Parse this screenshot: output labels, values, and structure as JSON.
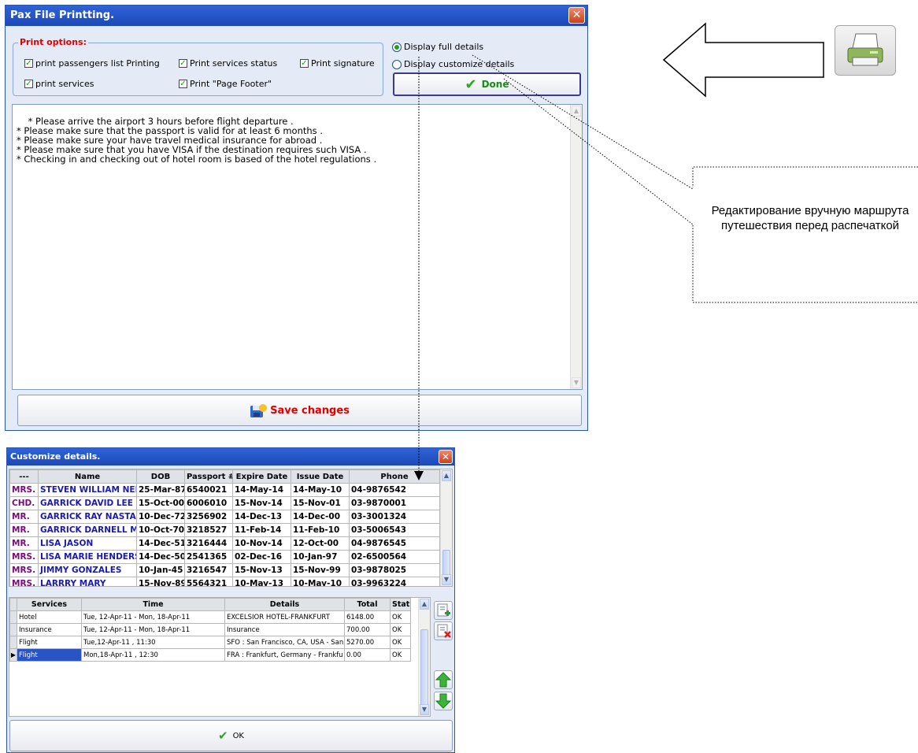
{
  "main_window": {
    "title": "Pax File Printting.",
    "print_options_title": "Print options:",
    "checkboxes": [
      {
        "label": "print passengers list Printing",
        "checked": true
      },
      {
        "label": "Print services status",
        "checked": true
      },
      {
        "label": "Print signature",
        "checked": true
      },
      {
        "label": "print services",
        "checked": true
      },
      {
        "label": "Print \"Page Footer\"",
        "checked": true
      }
    ],
    "radios": [
      {
        "label": "Display full details",
        "selected": true
      },
      {
        "label": "Display customize details",
        "selected": false
      }
    ],
    "done_label": "Done",
    "notes_text": "* Please arrive the airport 3 hours before flight departure .\n* Please make sure that the passport is valid for at least 6 months .\n* Please make sure your have travel medical insurance for abroad .\n* Please make sure that you have VISA if the destination requires such VISA .\n* Checking in and checking out of hotel room is based of the hotel regulations .",
    "save_label": "Save changes"
  },
  "customize_window": {
    "title": "Customize details.",
    "pax_headers": [
      "---",
      "Name",
      "DOB",
      "Passport #",
      "Expire Date",
      "Issue Date",
      "Phone"
    ],
    "pax_rows": [
      [
        "MRS.",
        "STEVEN WILLIAM NELS",
        "25-Mar-87",
        "6540021",
        "14-May-14",
        "14-May-10",
        "04-9876542"
      ],
      [
        "CHD.",
        "GARRICK DAVID LEE",
        "15-Oct-00",
        "6006010",
        "15-Nov-14",
        "15-Nov-01",
        "03-9870001"
      ],
      [
        "MR.",
        "GARRICK RAY NASTAS",
        "10-Dec-72",
        "3256902",
        "14-Dec-13",
        "14-Dec-00",
        "03-3001324"
      ],
      [
        "MR.",
        "GARRICK DARNELL MI",
        "10-Oct-70",
        "3218527",
        "11-Feb-14",
        "11-Feb-10",
        "03-5006543"
      ],
      [
        "MR.",
        "LISA JASON",
        "14-Dec-51",
        "3216444",
        "10-Nov-14",
        "12-Oct-00",
        "04-9876545"
      ],
      [
        "MRS.",
        "LISA MARIE HENDERSI",
        "14-Dec-50",
        "2541365",
        "02-Dec-16",
        "10-Jan-97",
        "02-6500564"
      ],
      [
        "MRS.",
        "JIMMY GONZALES",
        "10-Jan-45",
        "3216547",
        "15-Nov-13",
        "15-Nov-99",
        "03-9878025"
      ],
      [
        "MRS.",
        "LARRRY MARY",
        "15-Nov-89",
        "5564321",
        "10-May-13",
        "10-May-10",
        "03-9963224"
      ]
    ],
    "service_headers": [
      "Services",
      "Time",
      "Details",
      "Total",
      "Stat."
    ],
    "service_rows": [
      [
        "Hotel",
        "Tue, 12-Apr-11 - Mon, 18-Apr-11",
        "EXCELSIOR HOTEL-FRANKFURT",
        "6148.00",
        "OK"
      ],
      [
        "Insurance",
        "Tue, 12-Apr-11 - Mon, 18-Apr-11",
        "Insurance",
        "700.00",
        "OK"
      ],
      [
        "Flight",
        "Tue,12-Apr-11 , 11:30",
        "SFO : San Francisco, CA, USA - San",
        "5270.00",
        "OK"
      ],
      [
        "Flight",
        "Mon,18-Apr-11 , 12:30",
        "FRA : Frankfurt, Germany - Frankfu",
        "0.00",
        "OK"
      ]
    ],
    "ok_label": "OK"
  },
  "annotation": {
    "callout_text": "Редактирование вручную маршрута путешествия перед распечаткой"
  },
  "colors": {
    "title_bar": "#2f63d6",
    "group_title": "#e00000",
    "save_text": "#e00000",
    "done_text": "#1a8a1a",
    "pax_title": "#7a0a7a",
    "pax_name": "#1a1ab0",
    "selected_row": "#2a54c4"
  },
  "icons": [
    "close-icon",
    "checkmark-icon",
    "save-disk-icon",
    "printer-icon",
    "add-document-icon",
    "delete-document-icon",
    "arrow-up-icon",
    "arrow-down-icon",
    "hollow-left-arrow",
    "row-pointer-icon"
  ]
}
